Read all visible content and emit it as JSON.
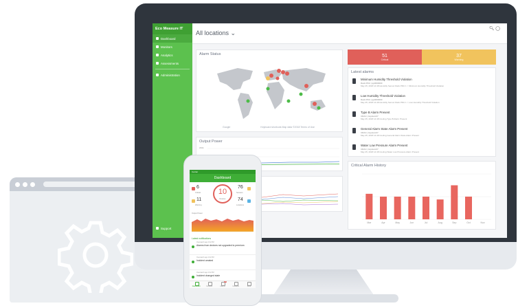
{
  "app": {
    "brand": "Eco Measure IT"
  },
  "sidebar": {
    "items": [
      {
        "label": "Dashboard",
        "icon": "home-icon",
        "active": true
      },
      {
        "label": "Monitors",
        "icon": "monitor-icon"
      },
      {
        "label": "Analytics",
        "icon": "user-icon"
      },
      {
        "label": "Assessments",
        "icon": "chart-icon"
      }
    ],
    "admin": "Administration",
    "support": "Support"
  },
  "header": {
    "location": "All locations ⌄",
    "icons": [
      "search-icon",
      "user-icon"
    ]
  },
  "alarm_status": {
    "title": "Alarm Status",
    "stat_left": "Google",
    "stat_right": "Keyboard shortcuts   Map data ©2018   Terms of Use"
  },
  "output_power": {
    "title": "Output Power",
    "ytick": "200k"
  },
  "counts": {
    "critical": {
      "value": "51",
      "label": "Critical",
      "color": "#e0605a"
    },
    "warning": {
      "value": "37",
      "label": "Warning",
      "color": "#f1c35d"
    }
  },
  "latest_alarms": {
    "title": "Latest alarms",
    "items": [
      {
        "title": "Minimum Humidity Threshold Violation",
        "sub": "Rack PDU | qp0000000",
        "meta": "May 25, 2018 14:48   Humidity Sensor   Rack PDU 1 > Minimum Humidity Threshold Violation"
      },
      {
        "title": "Low Humidity Threshold Violation",
        "sub": "Rack PDU | qp0000000",
        "meta": "May 25, 2018 14:48   Humidity Sensor   Rack PDU 1 > Low Humidity Threshold Violation"
      },
      {
        "title": "Type B Alarm Present",
        "sub": "CRAC | Asystem07",
        "meta": "May 25, 2018 14:48   Cooling   Type B Alarm Present"
      },
      {
        "title": "General Alarm State Alarm Present",
        "sub": "CRAC | Asystem07",
        "meta": "May 25, 2018 14:48   Cooling   General Alarm State Alarm Present"
      },
      {
        "title": "Water Low Pressure Alarm Present",
        "sub": "CRAC | Asystem07",
        "meta": "May 25, 2018 14:48   Cooling   Water Low Pressure Alarm Present"
      }
    ]
  },
  "critical_history": {
    "title": "Critical Alarm History",
    "color": "#e8665f"
  },
  "phone": {
    "status": "Carrier",
    "title": "Dashboard",
    "critical_count": "6",
    "critical_label": "Critical",
    "warning_count": "11",
    "warning_label": "Warning",
    "center_value": "10",
    "center_label": "Devices",
    "right_top": "76",
    "right_top_label": "Sensors",
    "right_bottom": "74",
    "right_bottom_label": "Locations",
    "chart_title": "Output Power",
    "notifications_title": "Latest notifications",
    "notifications": [
      {
        "meta": "Overwatch ago 4:02 PM",
        "text": "Alarms from devices not upgraded to premium"
      },
      {
        "meta": "Overwatch ago 4:02 PM",
        "text": "Incident created"
      },
      {
        "meta": "Overwatch ago 4:02 PM",
        "text": "Incident changed state"
      }
    ],
    "tabs": [
      "Dashboard",
      "Devices",
      "Alarms",
      "Incidents",
      "More"
    ],
    "alarm_badge": "14"
  },
  "chart_data": {
    "type": "bar",
    "title": "Critical Alarm History",
    "categories": [
      "Mar",
      "Apr",
      "May",
      "Jun",
      "Jul",
      "Aug",
      "Sep",
      "Oct",
      "Nov"
    ],
    "values": [
      4.5,
      4,
      4,
      4,
      4,
      3.5,
      6,
      4
    ],
    "ylim": [
      0,
      8
    ]
  }
}
